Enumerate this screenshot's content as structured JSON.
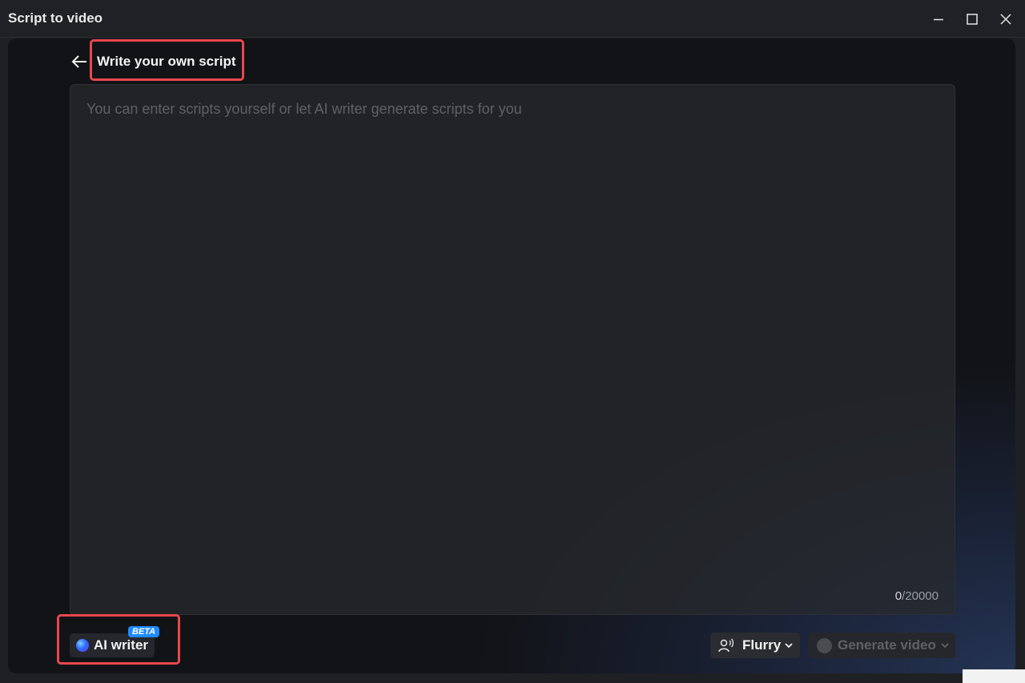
{
  "window": {
    "title": "Script to video",
    "minimize_icon": "minimize-icon",
    "maximize_icon": "maximize-icon",
    "close_icon": "close-icon"
  },
  "header": {
    "back_icon": "arrow-left-icon",
    "title": "Write your own script"
  },
  "editor": {
    "value": "",
    "placeholder": "You can enter scripts yourself or let AI writer generate scripts for you",
    "char_count": "0",
    "char_limit": "/20000"
  },
  "footer": {
    "ai_writer_label": "AI writer",
    "ai_writer_badge": "BETA",
    "voice_label": "Flurry",
    "voice_icon": "speaking-person-icon",
    "generate_label": "Generate video",
    "generate_enabled": false
  },
  "colors": {
    "highlight": "#e8474e",
    "badge": "#1e8bff",
    "background": "#121317"
  }
}
